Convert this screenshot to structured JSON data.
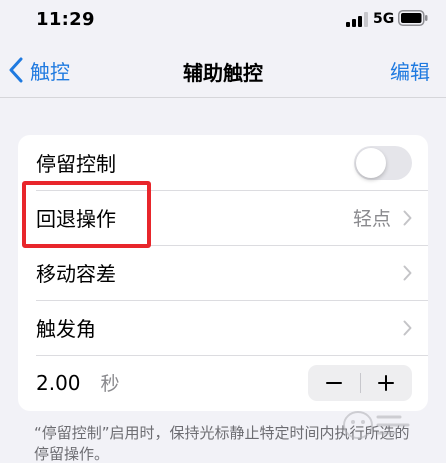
{
  "status_bar": {
    "time": "11:29",
    "network": "5G",
    "icons": [
      "signal-icon",
      "battery-icon"
    ]
  },
  "nav": {
    "back_label": "触控",
    "title": "辅助触控",
    "edit_label": "编辑"
  },
  "settings": {
    "rows": [
      {
        "label": "停留控制",
        "control": "toggle",
        "on": false
      },
      {
        "label": "回退操作",
        "value": "轻点",
        "control": "chevron"
      },
      {
        "label": "移动容差",
        "control": "chevron"
      },
      {
        "label": "触发角",
        "control": "chevron"
      }
    ],
    "duration": {
      "value": "2.00",
      "unit": "秒",
      "minus_label": "−",
      "plus_label": "+"
    }
  },
  "footer_note": "“停留控制”启用时，保持光标静止特定时间内执行所选的停留操作。",
  "annotation": {
    "highlight_color": "#e8262b",
    "target": "回退操作"
  },
  "colors": {
    "accent": "#1f7ae0",
    "background": "#f2f2f7",
    "secondary_text": "#8a8a8e"
  }
}
